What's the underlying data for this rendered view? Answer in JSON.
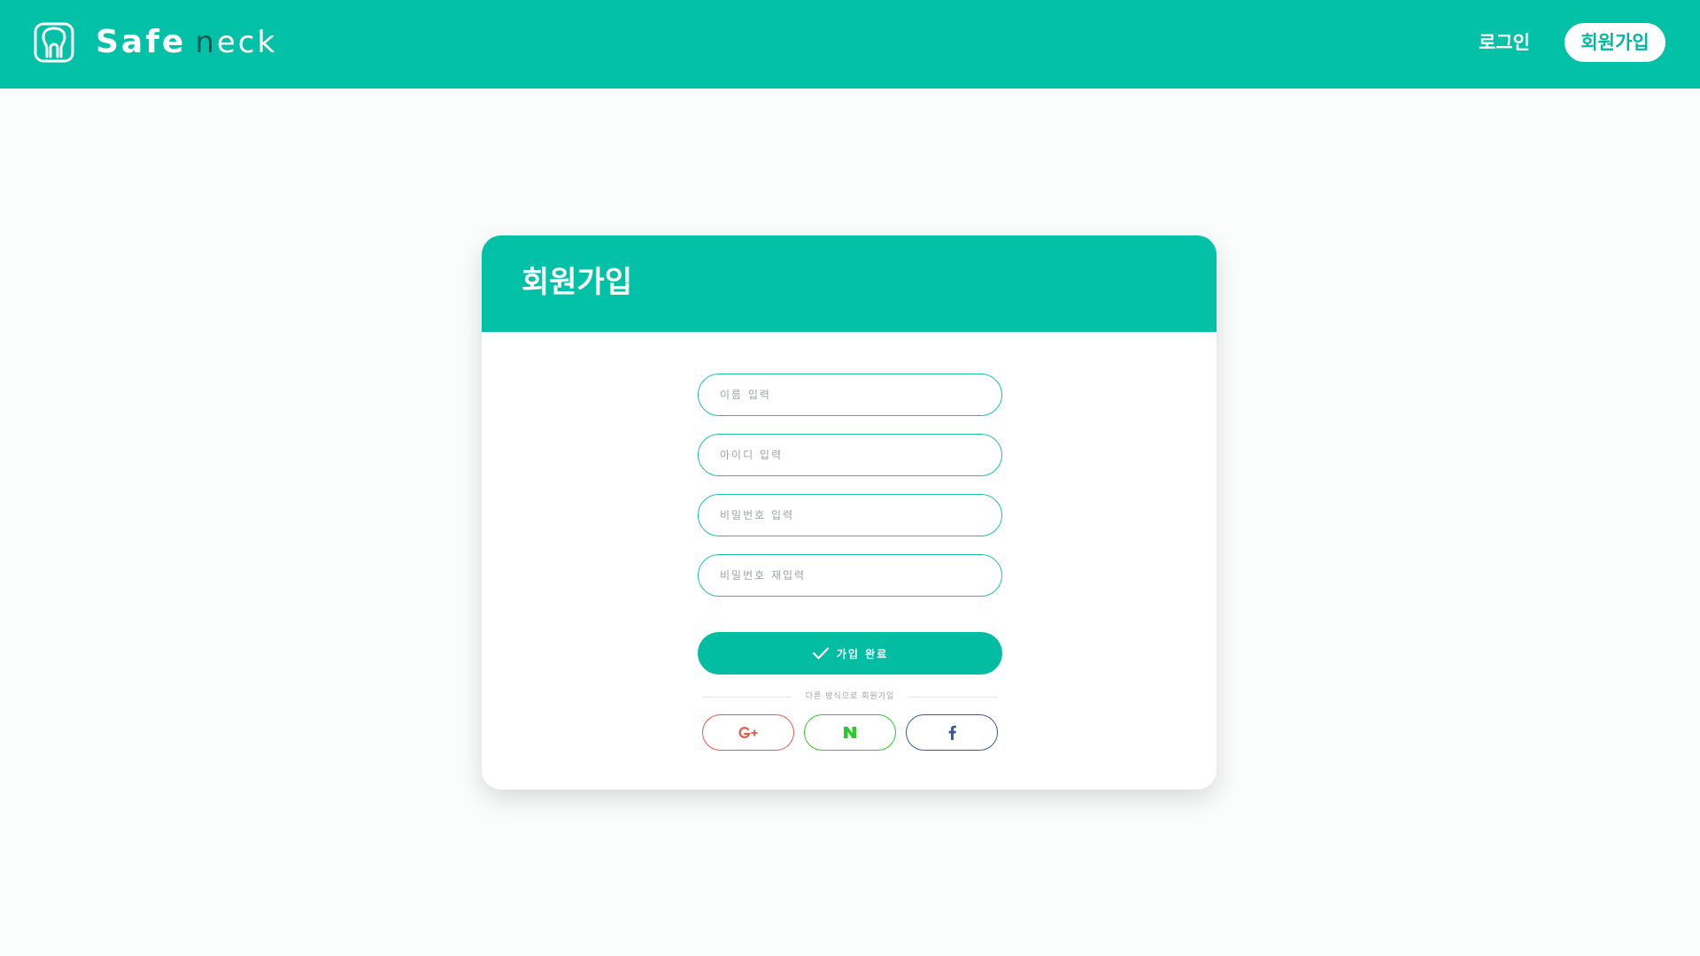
{
  "header": {
    "logo": {
      "icon": "safe-neck-logo-icon",
      "text_bold": "Safe",
      "text_light_first": "n",
      "text_light_rest": "eck"
    },
    "nav": {
      "login_label": "로그인",
      "signup_label": "회원가입"
    }
  },
  "card": {
    "title": "회원가입",
    "fields": {
      "name_placeholder": "이름 입력",
      "id_placeholder": "아이디 입력",
      "password_placeholder": "비밀번호 입력",
      "password_confirm_placeholder": "비밀번호 재입력"
    },
    "submit": {
      "icon": "check-icon",
      "label": "가입 완료"
    },
    "divider_text": "다른 방식으로 회원가입",
    "social": [
      {
        "name": "google",
        "icon": "google-plus-icon",
        "color": "#e8584d"
      },
      {
        "name": "naver",
        "icon": "naver-icon",
        "color": "#2dc92a"
      },
      {
        "name": "facebook",
        "icon": "facebook-icon",
        "color": "#3b5999"
      }
    ]
  },
  "colors": {
    "primary": "#03c1a7",
    "background": "#fbfdfd",
    "surface": "#ffffff"
  }
}
